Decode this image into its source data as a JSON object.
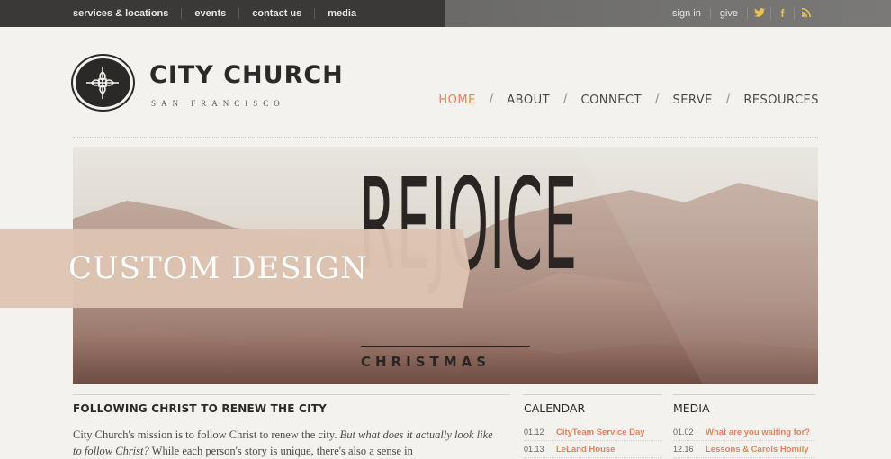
{
  "topbar": {
    "links": [
      "services & locations",
      "events",
      "contact us",
      "media"
    ],
    "right_links": [
      "sign in",
      "give"
    ],
    "social": [
      {
        "name": "twitter-icon",
        "glyph": "🐦",
        "color": "#e9c44a"
      },
      {
        "name": "facebook-icon",
        "glyph": "f",
        "color": "#e9c44a"
      },
      {
        "name": "rss-icon",
        "glyph": "∹",
        "color": "#e9c44a"
      }
    ]
  },
  "header": {
    "brand": "CITY CHURCH",
    "brand_sub": "SAN FRANCISCO"
  },
  "nav": {
    "items": [
      "HOME",
      "ABOUT",
      "CONNECT",
      "SERVE",
      "RESOURCES"
    ],
    "active": "HOME"
  },
  "hero": {
    "title": "REJOICE",
    "subtitle": "CHRISTMAS",
    "ribbon": "CUSTOM DESIGN"
  },
  "mission": {
    "title": "FOLLOWING CHRIST TO RENEW THE CITY",
    "text_part1": "City Church's mission is to follow Christ to renew the city. ",
    "text_em": "But what does it actually look like to follow Christ?",
    "text_part2": " While each person's story is unique, there's also a sense in"
  },
  "calendar": {
    "title": "CALENDAR",
    "items": [
      {
        "date": "01.12",
        "label": "CityTeam Service Day"
      },
      {
        "date": "01.13",
        "label": "LeLand House"
      }
    ]
  },
  "media": {
    "title": "MEDIA",
    "items": [
      {
        "date": "01.02",
        "label": "What are you waiting for?"
      },
      {
        "date": "12.16",
        "label": "Lessons & Carols Homily"
      }
    ]
  },
  "colors": {
    "accent": "#e8825b",
    "dark": "#2b2a28",
    "ribbon": "#dec4b2"
  }
}
